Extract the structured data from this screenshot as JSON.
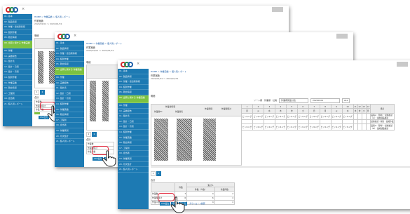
{
  "window": {
    "close_glyph": "×"
  },
  "breadcrumb": "HOME > 作業実績 > 個人別レポート",
  "heading": "作業実績",
  "date_range": "2024/01/01 ～ 2024/01/31",
  "section_detail": "明細",
  "section_total": "合計",
  "sidebar_items": [
    "01. 基本",
    "02. 製品情報",
    "03. 作業・担当者情報",
    "04. 個別作業",
    "05. 勤怠情報",
    "06. 作業工程登録",
    "07. 個別作業登録",
    "08. 出荷に関する情報",
    "09. 作業",
    "10. 実績報告",
    "11. 集計表",
    "12. 集計・日別",
    "13. 集計・月別",
    "14. 個別作業",
    "15. 作業実績",
    "16. 勤怠情報",
    "17. 工程別",
    "18. 担当者",
    "19. 作業者別",
    "20. 月次集計",
    "21. 個人別レポート"
  ],
  "active_sidebar_label": "08. 出荷に関する\n作業実績",
  "filter": {
    "sort_label": "ソート順",
    "option_a": "作業順",
    "option_b": "社員",
    "select_1": "作業者別集計表",
    "select_2": "20240101",
    "select_3": "ALL"
  },
  "grid_headers": {
    "group": "作業者情報",
    "col_a": "作業者ID",
    "col_b": "作業者名",
    "col_c": "作業時間",
    "col_d": "作業時間計"
  },
  "days": [
    "1",
    "2",
    "3",
    "4",
    "5",
    "6",
    "7",
    "8",
    "9",
    "10",
    "11",
    "12",
    "13",
    "14"
  ],
  "day_subs": [
    "月",
    "火",
    "水",
    "木",
    "金",
    "土",
    "日",
    "月",
    "火",
    "水",
    "木",
    "金",
    "土",
    "日"
  ],
  "remark_header": "備考",
  "rows": [
    {
      "cells": [
        "ピッキング",
        "ピッキング",
        "ピッキング",
        "ピッキング",
        "ピッキング",
        "ピッキング",
        "ピッキング",
        "ピッキング",
        "ピッキング",
        "ピッキング",
        "",
        "",
        "",
        ""
      ],
      "remark": "品番②（部材）・最終確認\n（A）・最終検品確認"
    },
    {
      "cells": [
        "",
        "",
        "",
        "",
        "",
        "",
        "",
        "",
        "",
        "",
        "",
        "",
        "",
        ""
      ],
      "remark": "最終確認・梱包・最終作業"
    },
    {
      "cells": [
        "ピッキング",
        "ピッキング",
        "ピッキング",
        "ピッキング",
        "ピッキング",
        "ピッキング",
        "ピッキング",
        "ピッキング",
        "ピッキング",
        "ピッキング",
        "",
        "",
        "",
        ""
      ],
      "remark": "品番③（部材）・最終確認\n（B）・最終検品確認"
    }
  ],
  "pager": [
    "1",
    "2"
  ],
  "summary": {
    "header_main": "件数",
    "header_group": "集計 1",
    "header_sub_1": "件数（人数）",
    "header_sub_2": "作業件数",
    "rows": [
      {
        "label": "作業数",
        "v1": "7",
        "v2": "4",
        "v3": "4"
      },
      {
        "label": "作業時間計",
        "v1": "6",
        "v2": "6",
        "v3": "4"
      },
      {
        "label": "作業人数",
        "v1": "",
        "v2": "4",
        "v3": "4"
      }
    ]
  },
  "buttons": {
    "csv": "CSV出力",
    "print": "印刷",
    "close": "閉じる",
    "link": "ダウンロード履歴"
  },
  "colors": {
    "sidebar": "#1d7ab3",
    "active": "#7cc242",
    "highlight": "#e2263b"
  },
  "icons": [
    "app-logo-icon",
    "close-icon",
    "hand-pointer-icon"
  ]
}
